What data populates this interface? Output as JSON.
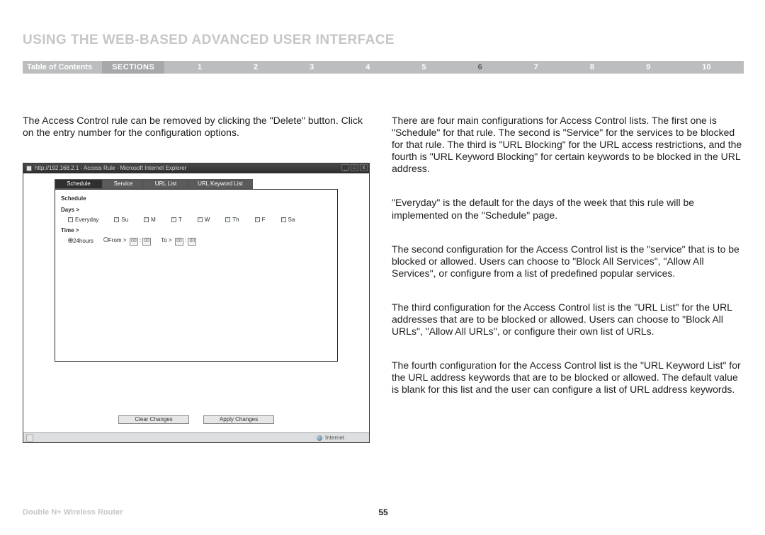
{
  "title": "USING THE WEB-BASED ADVANCED USER INTERFACE",
  "nav": {
    "toc": "Table of Contents",
    "sections_label": "SECTIONS",
    "numbers": [
      "1",
      "2",
      "3",
      "4",
      "5",
      "6",
      "7",
      "8",
      "9",
      "10"
    ],
    "active_index": 5
  },
  "left": {
    "p1": "The Access Control rule can be removed by clicking the \"Delete\" button. Click on the entry number for the configuration options."
  },
  "shot": {
    "title": "http://192.168.2.1 - Access Rule - Microsoft Internet Explorer",
    "winbtns": {
      "min": "_",
      "max": "□",
      "close": "X"
    },
    "tabs": [
      "Schedule",
      "Service",
      "URL List",
      "URL Keyword List"
    ],
    "panel": {
      "heading": "Schedule",
      "days_label": "Days >",
      "days": [
        "Everyday",
        "Su",
        "M",
        "T",
        "W",
        "Th",
        "F",
        "Sa"
      ],
      "time_label": "Time >",
      "time_24": "24hours",
      "from_label": "From >",
      "to_label": "To >",
      "dd": "00",
      "clear": "Clear Changes",
      "apply": "Apply Changes"
    },
    "status": {
      "zone": "Internet"
    }
  },
  "right": {
    "p1": "There are four main configurations for Access Control lists. The first one is \"Schedule\" for that rule. The second is \"Service\" for the services to be blocked for that rule. The third is \"URL Blocking\" for the URL access restrictions, and the fourth is \"URL Keyword Blocking\" for certain keywords to be blocked in the URL address.",
    "p2": "\"Everyday\" is the default for the days of the week that this rule will be implemented on the \"Schedule\" page.",
    "p3": "The second configuration for the Access Control list is the \"service\" that is to be blocked or allowed. Users can choose to \"Block All Services\", \"Allow All Services\", or configure from a list of predefined popular services.",
    "p4": "The third configuration for the Access Control list is the \"URL List\" for the URL addresses that are to be blocked or allowed. Users can choose to \"Block All URLs\", \"Allow All URLs\", or configure their own list of URLs.",
    "p5": "The fourth configuration for the Access Control list is the \"URL Keyword List\" for the URL address keywords that are to be blocked or allowed. The default value is blank for this list and the user can configure a list of URL address keywords."
  },
  "footer": {
    "product": "Double N+ Wireless Router",
    "page": "55"
  }
}
